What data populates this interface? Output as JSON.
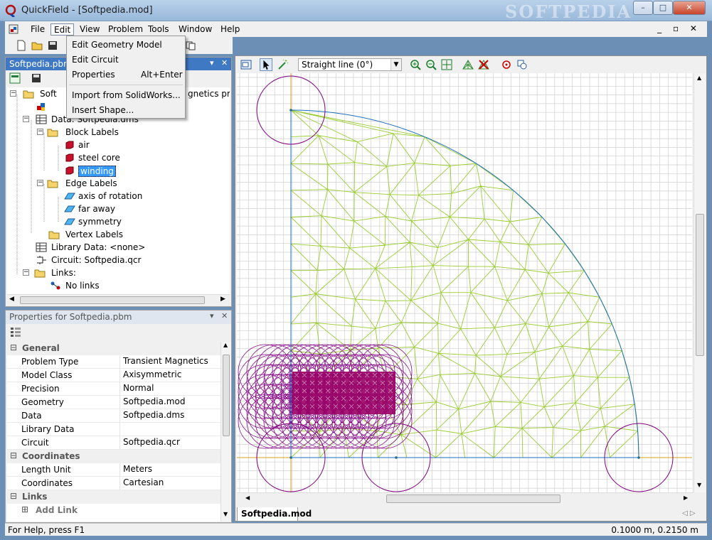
{
  "window": {
    "title": "QuickField - [Softpedia.mod]",
    "watermark": "SOFTPEDIA",
    "controls": [
      "–",
      "□",
      "✕"
    ]
  },
  "menubar": {
    "items": [
      "File",
      "Edit",
      "View",
      "Problem",
      "Tools",
      "Window",
      "Help"
    ],
    "mdi_controls": "_ ▫ ✕"
  },
  "edit_menu": {
    "items": [
      {
        "label": "Edit Geometry Model",
        "shortcut": ""
      },
      {
        "label": "Edit Circuit",
        "shortcut": ""
      },
      {
        "label": "Properties",
        "shortcut": "Alt+Enter"
      },
      {
        "label": "Import from SolidWorks...",
        "shortcut": ""
      },
      {
        "label": "Insert Shape...",
        "shortcut": ""
      }
    ]
  },
  "tree_panel": {
    "title": "Softpedia.pbm",
    "rows": [
      {
        "label": "Softpedia.pbm - Transient Magnetics problem",
        "ic": "folder"
      },
      {
        "label": "",
        "ic": "model"
      },
      {
        "label": "Data: Softpedia.dms",
        "ic": "data"
      },
      {
        "label": "Block Labels",
        "ic": "folder"
      },
      {
        "label": "air",
        "ic": "block"
      },
      {
        "label": "steel core",
        "ic": "block"
      },
      {
        "label": "winding",
        "ic": "block"
      },
      {
        "label": "Edge Labels",
        "ic": "folder"
      },
      {
        "label": "axis of rotation",
        "ic": "edge"
      },
      {
        "label": "far away",
        "ic": "edge"
      },
      {
        "label": "symmetry",
        "ic": "edge"
      },
      {
        "label": "Vertex Labels",
        "ic": "folder"
      },
      {
        "label": "Library Data: <none>",
        "ic": "data"
      },
      {
        "label": "Circuit: Softpedia.qcr",
        "ic": "circuit"
      },
      {
        "label": "Links:",
        "ic": "folder"
      },
      {
        "label": "No links",
        "ic": "link"
      }
    ],
    "visible_labels": [
      "Soft",
      "gnetics prob",
      "Data: Softpedia.dms",
      "Block Labels",
      "air",
      "steel core",
      "winding",
      "Edge Labels",
      "axis of rotation",
      "far away",
      "symmetry",
      "Vertex Labels",
      "Library Data: <none>",
      "Circuit: Softpedia.qcr",
      "Links:",
      "No links"
    ],
    "selected": "winding"
  },
  "properties_panel": {
    "title": "Properties for Softpedia.pbm",
    "sections": [
      {
        "category": "General",
        "rows": [
          {
            "key": "Problem Type",
            "value": "Transient Magnetics"
          },
          {
            "key": "Model Class",
            "value": "Axisymmetric"
          },
          {
            "key": "Precision",
            "value": "Normal"
          },
          {
            "key": "Geometry",
            "value": "Softpedia.mod"
          },
          {
            "key": "Data",
            "value": "Softpedia.dms"
          },
          {
            "key": "Library Data",
            "value": ""
          },
          {
            "key": "Circuit",
            "value": "Softpedia.qcr"
          }
        ]
      },
      {
        "category": "Coordinates",
        "rows": [
          {
            "key": "Length Unit",
            "value": "Meters"
          },
          {
            "key": "Coordinates",
            "value": "Cartesian"
          }
        ]
      },
      {
        "category": "Links",
        "rows": []
      }
    ],
    "add_link": "Add Link"
  },
  "geometry_toolbar": {
    "mode": "Straight line (0°)"
  },
  "geometry_tab": "Softpedia.mod",
  "status": {
    "help": "For Help, press F1",
    "coords": "0.1000 m, 0.2150 m"
  },
  "colors": {
    "mesh": "#9acd32",
    "edge": "#1e6fc0",
    "axis": "#d4a017",
    "circle": "#800080",
    "winding_fill": "#990066"
  }
}
